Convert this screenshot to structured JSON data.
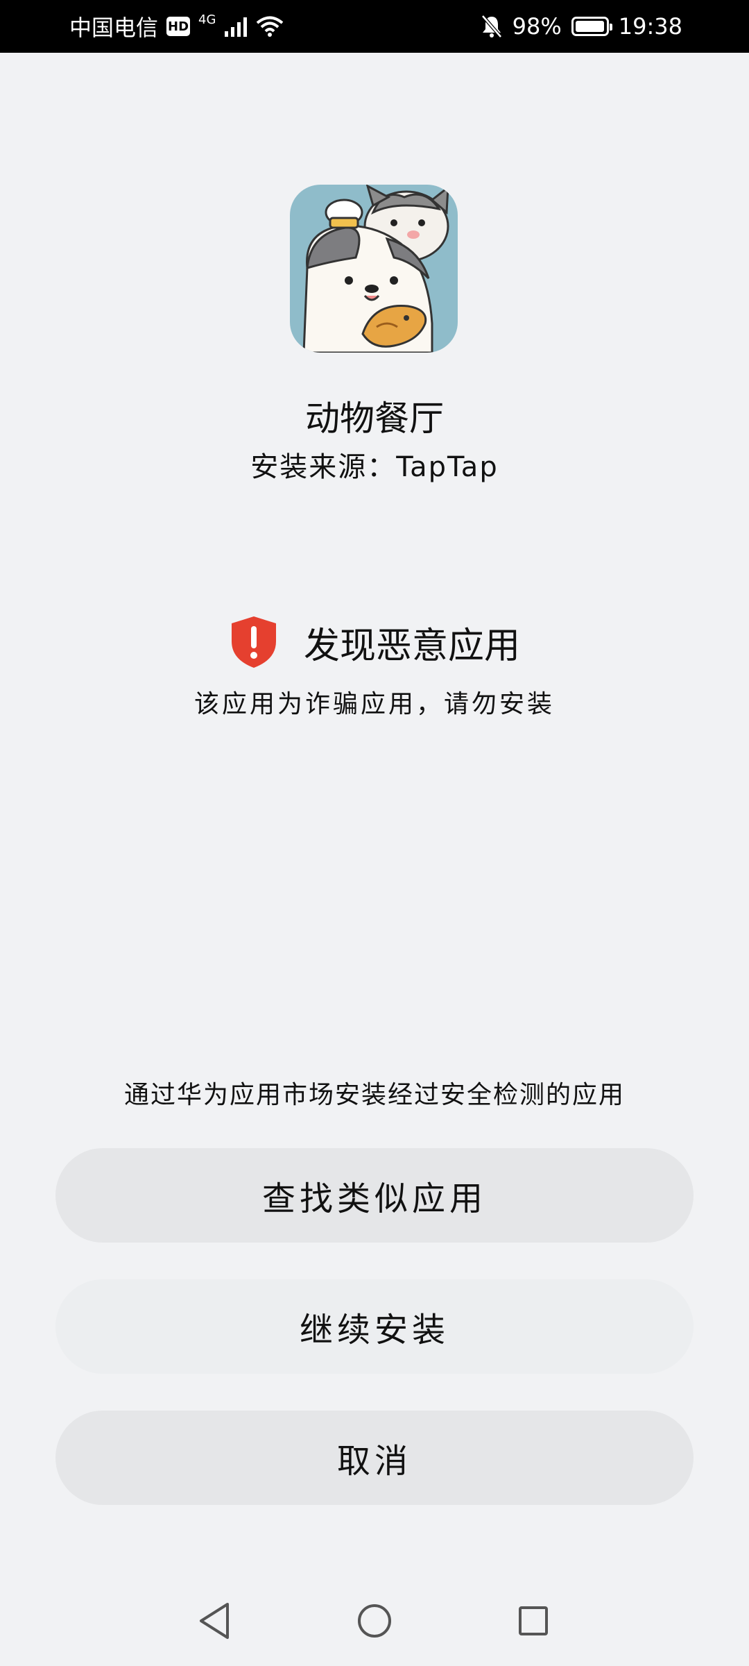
{
  "status_bar": {
    "carrier": "中国电信",
    "hd_badge": "HD",
    "network_gen": "4G",
    "battery_percent": "98%",
    "battery_level": 0.98,
    "time": "19:38",
    "icons": [
      "signal-icon",
      "wifi-icon",
      "mute-bell-icon",
      "battery-icon"
    ]
  },
  "app": {
    "name": "动物餐厅",
    "source": "安装来源：TapTap"
  },
  "warning": {
    "title": "发现恶意应用",
    "description": "该应用为诈骗应用，请勿安装",
    "icon": "shield-alert-icon",
    "color": "#e5402f"
  },
  "hint": "通过华为应用市场安装经过安全检测的应用",
  "buttons": {
    "find_similar": "查找类似应用",
    "continue_install": "继续安装",
    "cancel": "取消"
  },
  "nav": {
    "icons": [
      "back-icon",
      "home-icon",
      "recents-icon"
    ]
  }
}
